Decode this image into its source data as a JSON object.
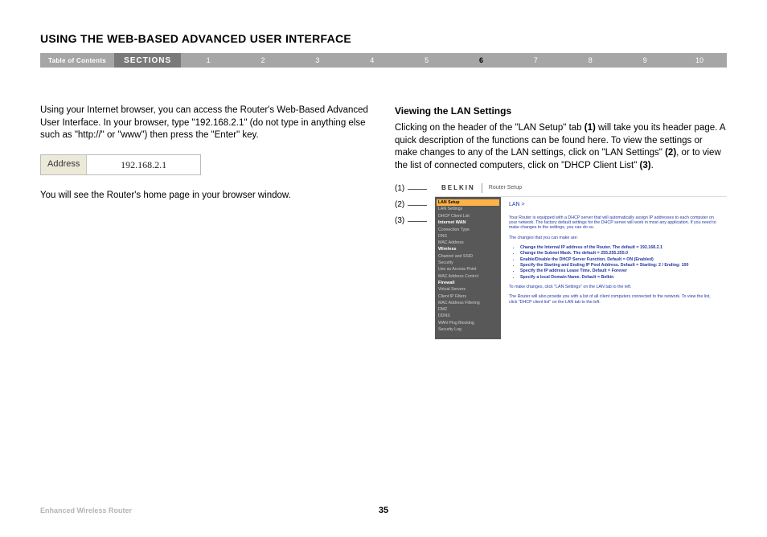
{
  "title": "USING THE WEB-BASED ADVANCED USER INTERFACE",
  "nav": {
    "toc": "Table of Contents",
    "sections": "SECTIONS",
    "nums": [
      "1",
      "2",
      "3",
      "4",
      "5",
      "6",
      "7",
      "8",
      "9",
      "10"
    ],
    "active": "6"
  },
  "left": {
    "p1": "Using your Internet browser, you can access the Router's Web-Based Advanced User Interface. In your browser, type \"192.168.2.1\" (do not type in anything else such as \"http://\" or \"www\") then press the \"Enter\" key.",
    "addr_label": "Address",
    "addr_value": "192.168.2.1",
    "p2": "You will see the Router's home page in your browser window."
  },
  "right": {
    "subhead": "Viewing the LAN Settings",
    "p1a": "Clicking on the header of the \"LAN Setup\" tab ",
    "b1": "(1)",
    "p1b": " will take you its header page. A quick description of the functions can be found here. To view the settings or make changes to any of the LAN settings, click on \"LAN Settings\" ",
    "b2": "(2)",
    "p1c": ", or to view the list of connected computers, click on \"DHCP Client List\" ",
    "b3": "(3)",
    "p1d": "."
  },
  "callouts": [
    "(1)",
    "(2)",
    "(3)"
  ],
  "ui": {
    "brand": "BELKIN",
    "subtitle": "Router Setup",
    "side": [
      {
        "t": "LAN Setup",
        "c": "hl"
      },
      {
        "t": "LAN Settings",
        "c": ""
      },
      {
        "t": "DHCP Client List",
        "c": ""
      },
      {
        "t": "Internet WAN",
        "c": "hd"
      },
      {
        "t": "Connection Type",
        "c": ""
      },
      {
        "t": "DNS",
        "c": ""
      },
      {
        "t": "MAC Address",
        "c": ""
      },
      {
        "t": "Wireless",
        "c": "hd"
      },
      {
        "t": "Channel and SSID",
        "c": ""
      },
      {
        "t": "Security",
        "c": ""
      },
      {
        "t": "Use as Access Point",
        "c": ""
      },
      {
        "t": "MAC Address Control",
        "c": ""
      },
      {
        "t": "Firewall",
        "c": "hd"
      },
      {
        "t": "Virtual Servers",
        "c": ""
      },
      {
        "t": "Client IP Filters",
        "c": ""
      },
      {
        "t": "MAC Address Filtering",
        "c": ""
      },
      {
        "t": "DMZ",
        "c": ""
      },
      {
        "t": "DDNS",
        "c": ""
      },
      {
        "t": "WAN Ping Blocking",
        "c": ""
      },
      {
        "t": "Security Log",
        "c": ""
      }
    ],
    "main": {
      "lan": "LAN >",
      "intro": "Your Router is equipped with a DHCP server that will automatically assign IP addresses to each computer on your network. The factory default settings for the DHCP server will work in most any application. If you need to make changes to the settings, you can do so.",
      "changes": "The changes that you can make are:",
      "bullets": [
        "Change the Internal IP address of the Router. The default = 192.168.2.1",
        "Change the Subnet Mask. The default = 255.255.255.0",
        "Enable/Disable the DHCP Server Function. Default = ON (Enabled)",
        "Specify the Starting and Ending IP Pool Address. Default = Starting: 2 / Ending: 100",
        "Specify the IP address Lease Time. Default = Forever",
        "Specify a local Domain Name. Default = Belkin"
      ],
      "note1": "To make changes, click \"LAN Settings\" on the LAN tab to the left.",
      "note2": "The Router will also provide you with a list of all client computers connected to the network. To view the list, click \"DHCP client list\" on the LAN tab to the left."
    }
  },
  "footer": {
    "title": "Enhanced Wireless Router",
    "page": "35"
  }
}
